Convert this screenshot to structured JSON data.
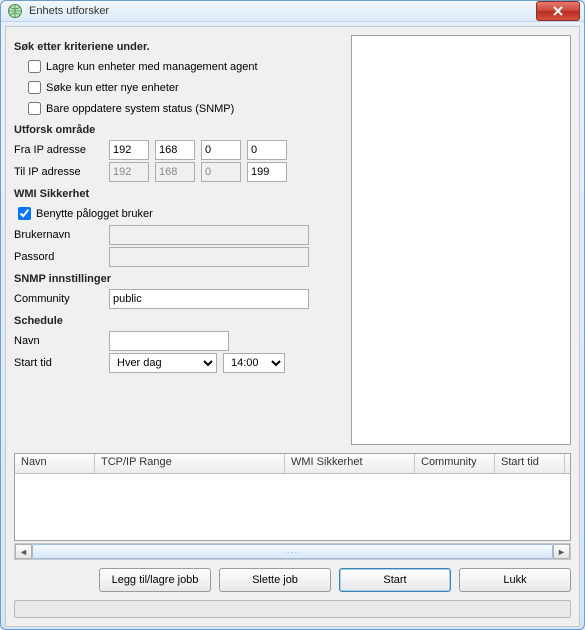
{
  "window": {
    "title": "Enhets utforsker"
  },
  "criteria": {
    "heading": "Søk etter kriteriene under.",
    "only_agent": "Lagre kun enheter med management agent",
    "only_new": "Søke kun etter nye enheter",
    "only_snmp": "Bare oppdatere system status (SNMP)"
  },
  "range": {
    "heading": "Utforsk område",
    "from_label": "Fra IP adresse",
    "to_label": "Til IP adresse",
    "from": [
      "192",
      "168",
      "0",
      "0"
    ],
    "to": [
      "192",
      "168",
      "0",
      "199"
    ]
  },
  "wmi": {
    "heading": "WMI Sikkerhet",
    "use_logged_on": "Benytte pålogget bruker",
    "user_label": "Brukernavn",
    "pass_label": "Passord",
    "user": "",
    "pass": ""
  },
  "snmp": {
    "heading": "SNMP innstillinger",
    "community_label": "Community",
    "community": "public"
  },
  "schedule": {
    "heading": "Schedule",
    "name_label": "Navn",
    "name": "",
    "start_label": "Start tid",
    "freq": "Hver dag",
    "time": "14:00"
  },
  "grid": {
    "cols": [
      "Navn",
      "TCP/IP Range",
      "WMI Sikkerhet",
      "Community",
      "Start tid"
    ],
    "rows": []
  },
  "buttons": {
    "add": "Legg til/lagre jobb",
    "delete": "Slette job",
    "start": "Start",
    "close": "Lukk"
  }
}
